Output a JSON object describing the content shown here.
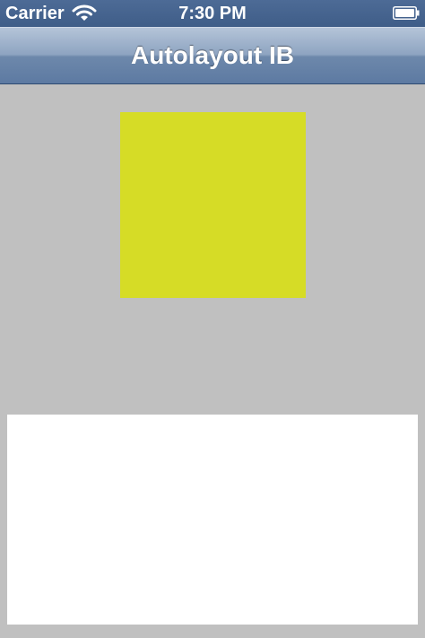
{
  "status_bar": {
    "carrier": "Carrier",
    "time": "7:30 PM",
    "wifi_icon": "wifi-icon",
    "battery_icon": "battery-icon"
  },
  "nav_bar": {
    "title": "Autolayout IB"
  },
  "content": {
    "background_color": "#c0c0c0",
    "square_color": "#d6dc26",
    "panel_color": "#ffffff"
  }
}
